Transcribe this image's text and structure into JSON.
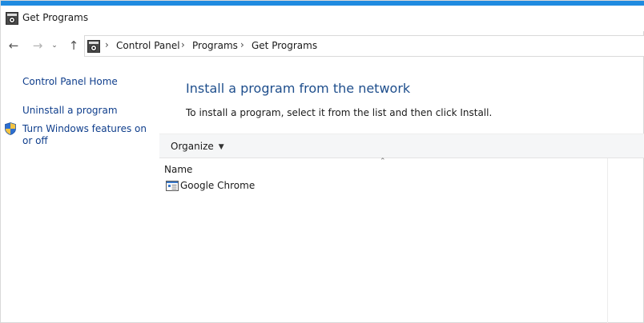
{
  "window": {
    "title": "Get Programs",
    "accent_color": "#1f8be0"
  },
  "navigation": {
    "back_icon": "arrow-left-icon",
    "forward_icon": "arrow-right-icon",
    "recent_icon": "chevron-down-icon",
    "up_icon": "arrow-up-icon"
  },
  "address_bar": {
    "icon": "control-panel-icon",
    "breadcrumbs": [
      "Control Panel",
      "Programs",
      "Get Programs"
    ]
  },
  "sidebar": {
    "home_link": "Control Panel Home",
    "links": [
      "Uninstall a program",
      "Turn Windows features on or off"
    ],
    "shield_icon": "uac-shield-icon"
  },
  "main": {
    "heading": "Install a program from the network",
    "instruction": "To install a program, select it from the list and then click Install.",
    "toolbar": {
      "organize_label": "Organize"
    },
    "columns": [
      "Name"
    ],
    "programs": [
      {
        "name": "Google Chrome",
        "icon": "program-installer-icon"
      }
    ]
  },
  "colors": {
    "link": "#0f3e8c",
    "heading": "#1e4e8c",
    "toolbar_bg": "#f5f6f7"
  }
}
